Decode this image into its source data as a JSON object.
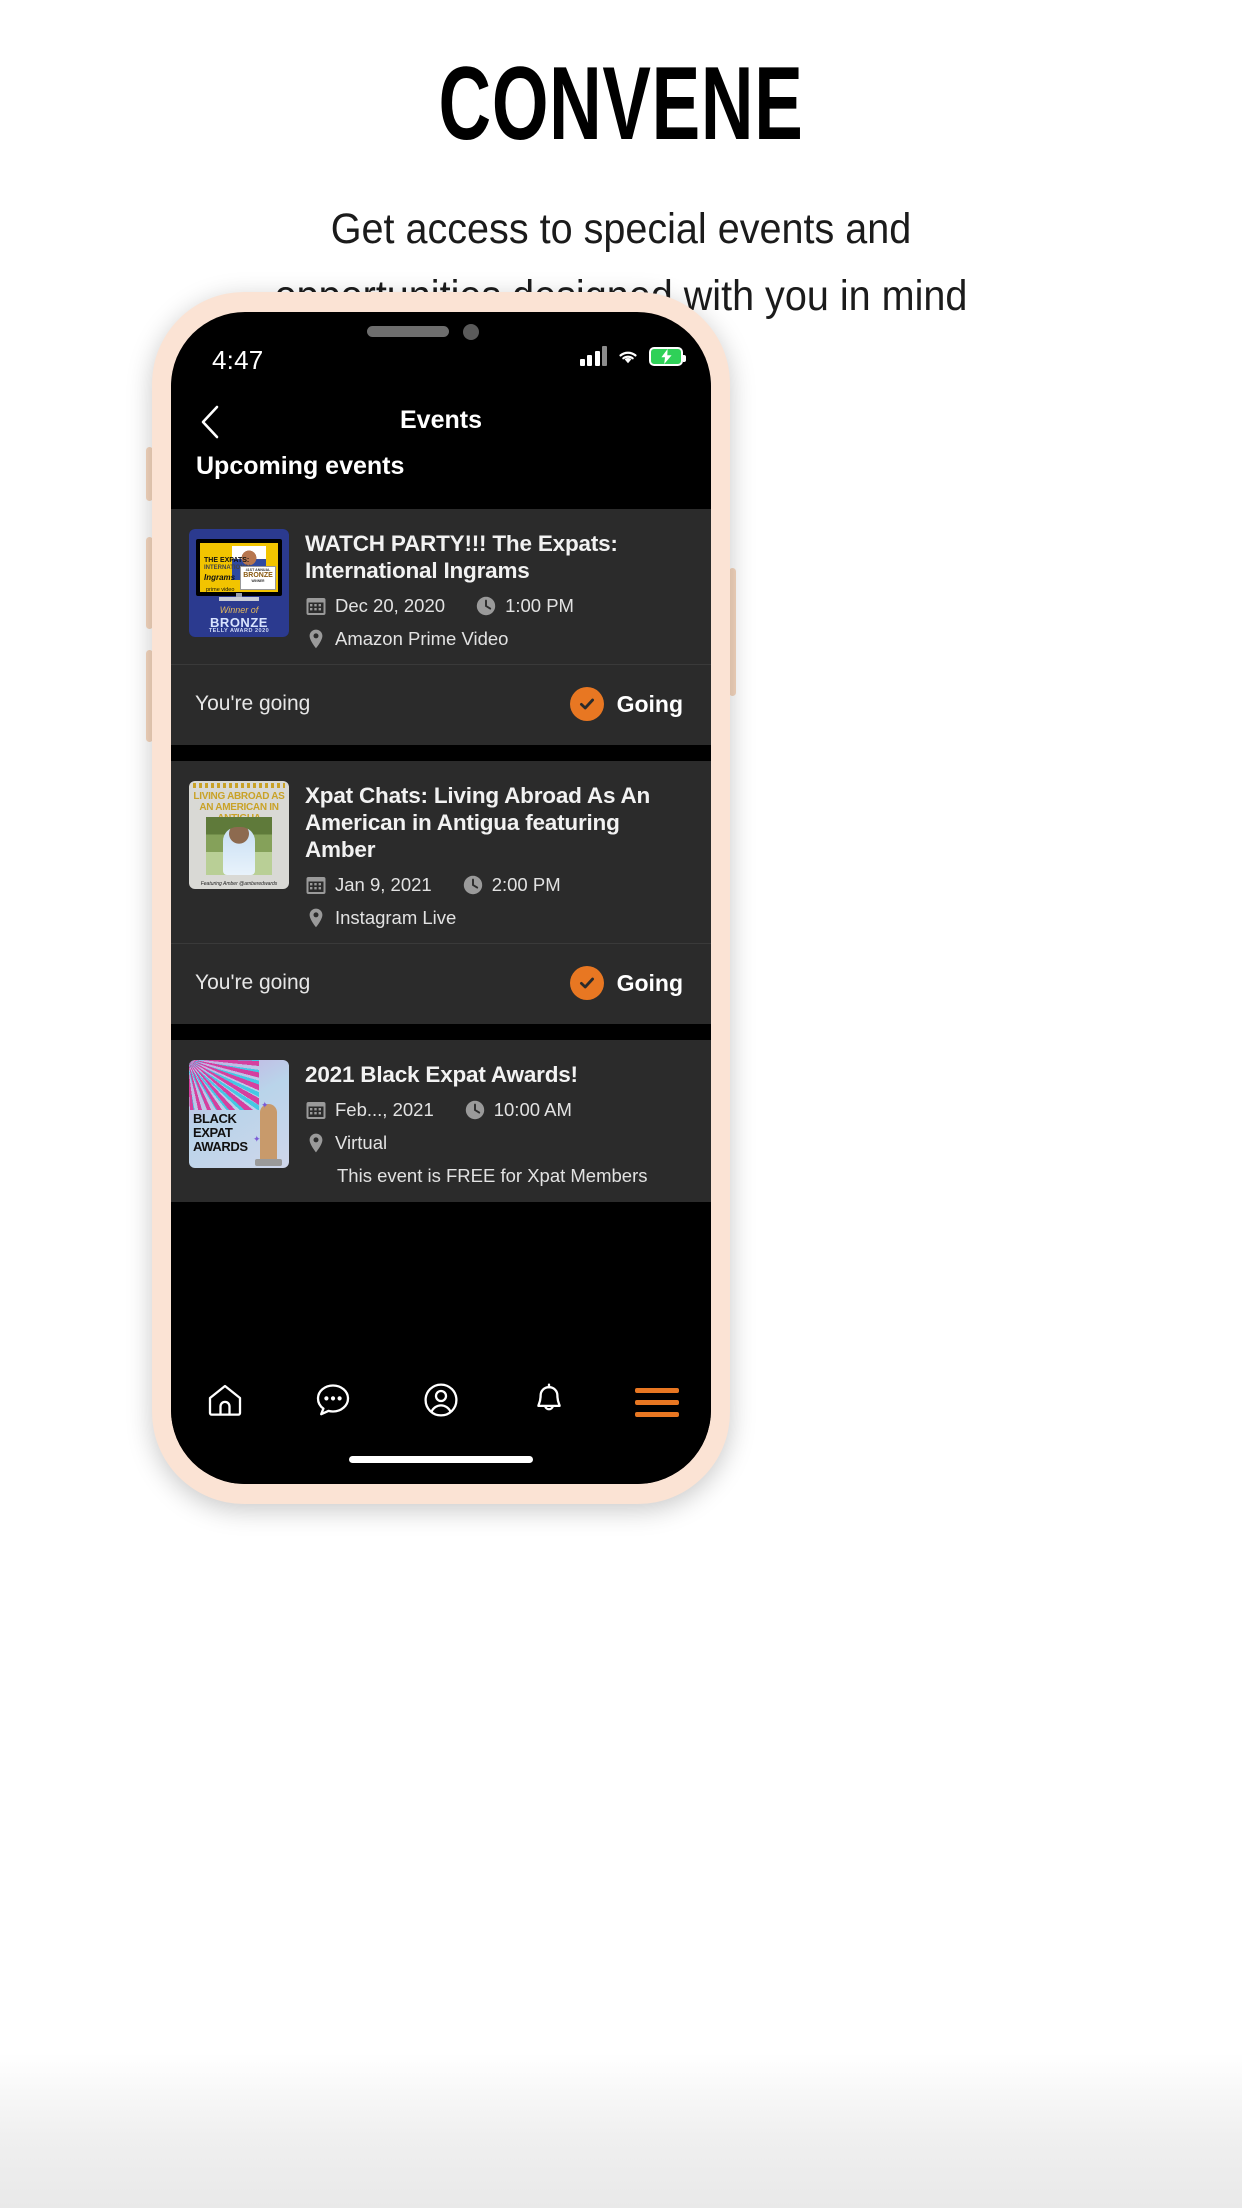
{
  "promo": {
    "title": "CONVENE",
    "subtitle_line1": "Get access to special events and",
    "subtitle_line2": "opportunities designed with you in mind"
  },
  "colors": {
    "accent_orange": "#E87722",
    "card_bg": "#2B2B2B",
    "screen_bg": "#000000",
    "phone_frame": "#FBE3D4",
    "battery_green": "#2FD158"
  },
  "status_bar": {
    "time": "4:47",
    "signal_icon": "cellular-bars-icon",
    "wifi_icon": "wifi-icon",
    "battery_icon": "battery-charging-icon"
  },
  "header": {
    "back_icon": "back-chevron-icon",
    "title": "Events",
    "section_title": "Upcoming events"
  },
  "events": [
    {
      "title": "WATCH PARTY!!! The Expats: International Ingrams",
      "date": "Dec 20, 2020",
      "time": "1:00 PM",
      "location": "Amazon Prime Video",
      "note": "",
      "rsvp_status_text": "You're going",
      "rsvp_button_label": "Going",
      "thumb_alt": "expats-international-ingrams-poster",
      "thumb_text": {
        "line1": "THE EXPATS:",
        "line2": "INTERNATIONAL",
        "line3": "Ingrams",
        "line4": "prime video",
        "badge_top": "41ST  ANNUAL",
        "badge_mid": "BRONZE",
        "badge_bot": "WINNER",
        "footer1": "Winner of",
        "footer2": "BRONZE",
        "footer3": "TELLY AWARD 2020"
      }
    },
    {
      "title": "Xpat Chats: Living Abroad As An American in Antigua featuring Amber",
      "date": "Jan 9, 2021",
      "time": "2:00 PM",
      "location": "Instagram Live",
      "note": "",
      "rsvp_status_text": "You're going",
      "rsvp_button_label": "Going",
      "thumb_alt": "living-abroad-antigua-poster",
      "thumb_text": {
        "headline": "LIVING ABROAD AS AN AMERICAN IN ANTIGUA",
        "caption": "Featuring Amber @amberedwards"
      }
    },
    {
      "title": "2021 Black Expat Awards!",
      "date": "Feb..., 2021",
      "time": "10:00 AM",
      "location": "Virtual",
      "note": "This event is FREE for Xpat Members",
      "rsvp_status_text": "",
      "rsvp_button_label": "",
      "thumb_alt": "black-expat-awards-poster",
      "thumb_text": {
        "headline": "BLACK EXPAT AWARDS"
      }
    }
  ],
  "tabbar": {
    "items": [
      {
        "icon": "home-icon",
        "name": "home"
      },
      {
        "icon": "chat-bubble-icon",
        "name": "messages"
      },
      {
        "icon": "profile-circle-icon",
        "name": "profile"
      },
      {
        "icon": "bell-icon",
        "name": "notifications"
      },
      {
        "icon": "hamburger-menu-icon",
        "name": "menu"
      }
    ]
  },
  "meta_icons": {
    "calendar": "calendar-icon",
    "clock": "clock-icon",
    "pin": "location-pin-icon",
    "check": "check-circle-icon"
  }
}
